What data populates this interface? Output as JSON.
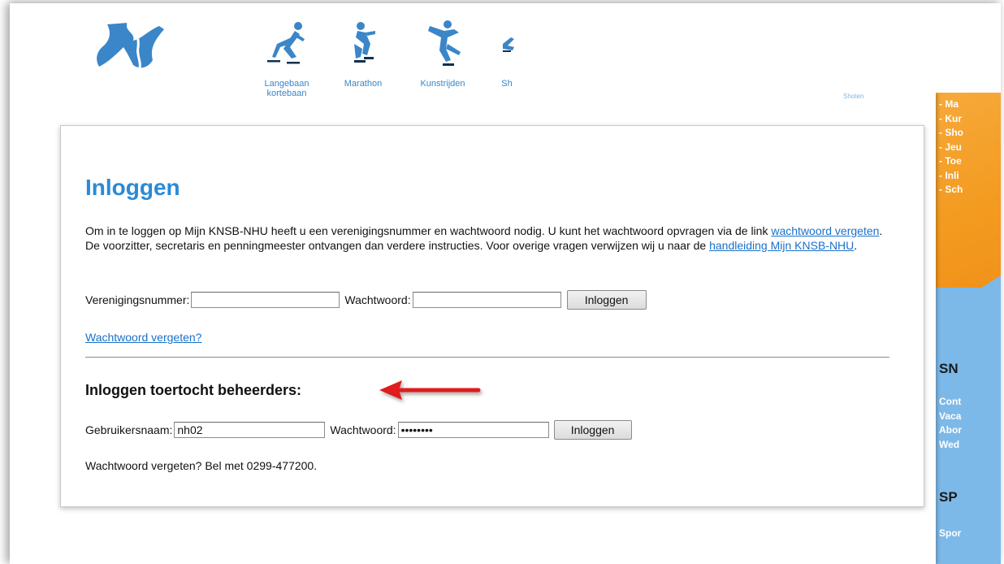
{
  "nav": {
    "items": [
      {
        "label_line1": "Langebaan",
        "label_line2": "kortebaan",
        "icon": "long-track-skater-icon"
      },
      {
        "label_line1": "Marathon",
        "label_line2": "",
        "icon": "marathon-skater-icon"
      },
      {
        "label_line1": "Kunstrijden",
        "label_line2": "",
        "icon": "figure-skater-icon"
      },
      {
        "label_line1": "Sh",
        "label_line2": "",
        "icon": "short-track-skater-icon"
      }
    ],
    "faint_text": "Shoten"
  },
  "sidebar": {
    "menu": [
      "- Ma",
      "- Kur",
      "- Sho",
      "- Jeu",
      "- Toe",
      "- Inli",
      "- Sch"
    ],
    "heading1": "SN",
    "links1": [
      "Cont",
      "Vaca",
      "Abor",
      "Wed"
    ],
    "heading2": "SP",
    "links2": [
      "Spor"
    ],
    "colors": {
      "orange": "#f39a1f",
      "blue": "#7db9e8"
    }
  },
  "login": {
    "title": "Inloggen",
    "intro_part1": "Om in te loggen op Mijn KNSB-NHU heeft u een verenigingsnummer en wachtwoord nodig. U kunt het wachtwoord opvragen via de link ",
    "intro_link1": "wachtwoord vergeten",
    "intro_part2": ". De voorzitter, secretaris en penningmeester ontvangen dan verdere instructies. Voor overige vragen verwijzen wij u naar de ",
    "intro_link2": "handleiding Mijn KNSB-NHU",
    "intro_part3": ".",
    "club_label": "Verenigingsnummer:",
    "club_value": "",
    "password_label": "Wachtwoord:",
    "password_value": "",
    "button": "Inloggen",
    "forgot_link": "Wachtwoord vergeten?"
  },
  "tour_login": {
    "title": "Inloggen toertocht beheerders:",
    "username_label": "Gebruikersnaam:",
    "username_value": "nh02",
    "password_label": "Wachtwoord:",
    "password_value": "12345678",
    "button": "Inloggen",
    "note": "Wachtwoord vergeten? Bel met 0299-477200."
  },
  "accent_colors": {
    "title": "#2a8ad6",
    "link": "#1a70c8",
    "arrow": "#e01b1b"
  }
}
